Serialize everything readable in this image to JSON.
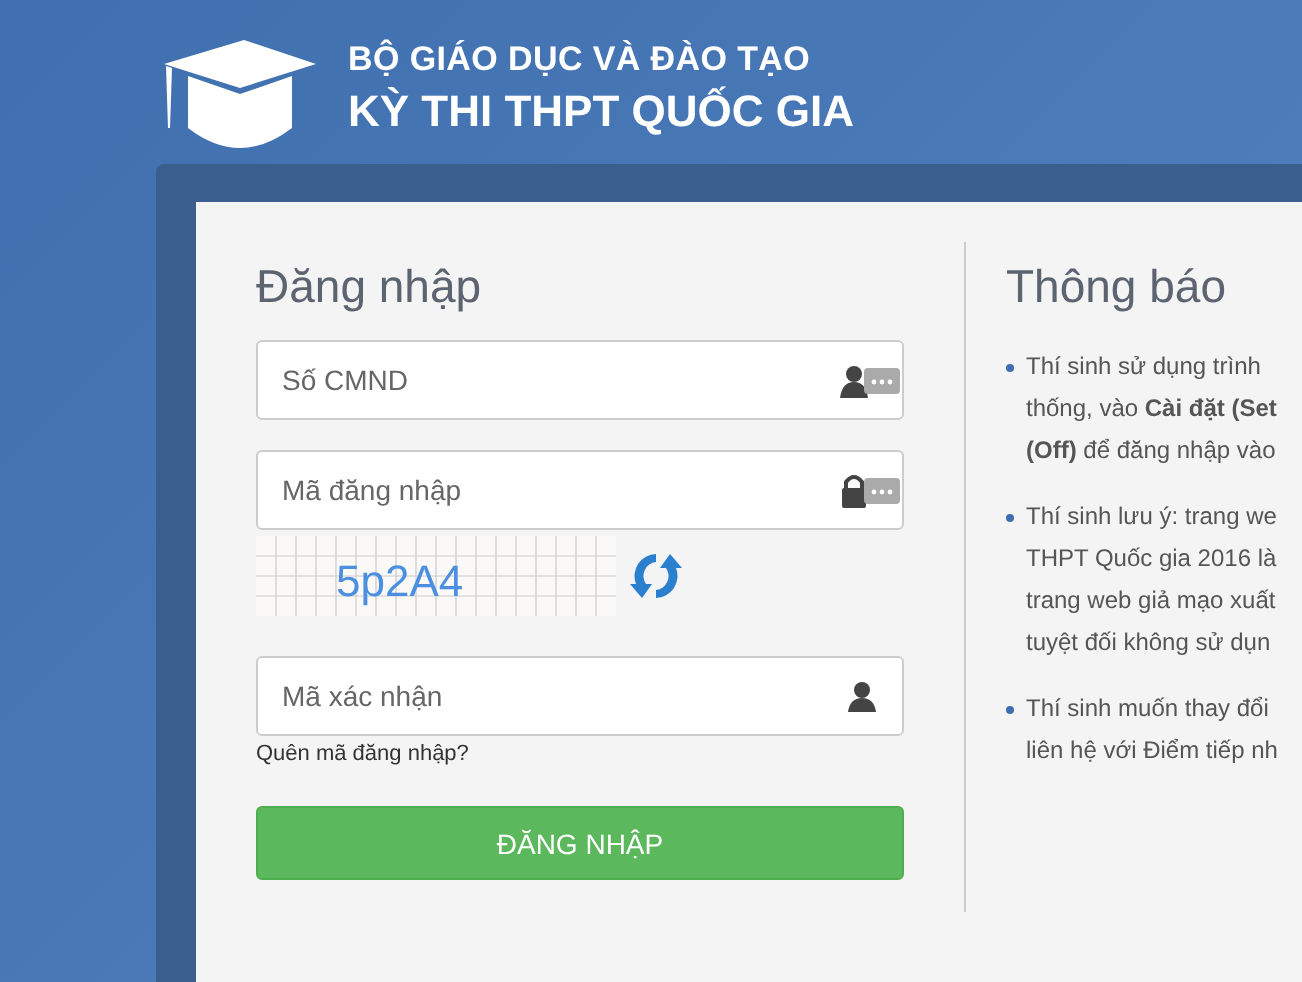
{
  "header": {
    "ministry": "BỘ GIÁO DỤC VÀ ĐÀO TẠO",
    "exam": "KỲ THI THPT QUỐC GIA"
  },
  "login": {
    "title": "Đăng nhập",
    "fields": [
      {
        "placeholder": "Số CMND",
        "kind": "id"
      },
      {
        "placeholder": "Mã đăng nhập",
        "kind": "password"
      }
    ],
    "captcha": "5p2A4",
    "confirm_field": {
      "placeholder": "Mã xác nhận"
    },
    "forgot_link": "Quên mã đăng nhập?",
    "submit": "ĐĂNG NHẬP"
  },
  "notice": {
    "title": "Thông báo",
    "items": [
      {
        "lines": [
          "Thí sinh sử dụng trình",
          "thống, vào **Cài đặt (Set**",
          "**(Off)** để đăng nhập vào"
        ]
      },
      {
        "lines": [
          "Thí sinh lưu ý: trang we",
          "THPT Quốc gia 2016 là",
          "trang web giả mạo xuất",
          "tuyệt đối không sử dụn"
        ]
      },
      {
        "lines": [
          "Thí sinh muốn thay đổi",
          "liên hệ với Điểm tiếp nh"
        ]
      }
    ]
  }
}
